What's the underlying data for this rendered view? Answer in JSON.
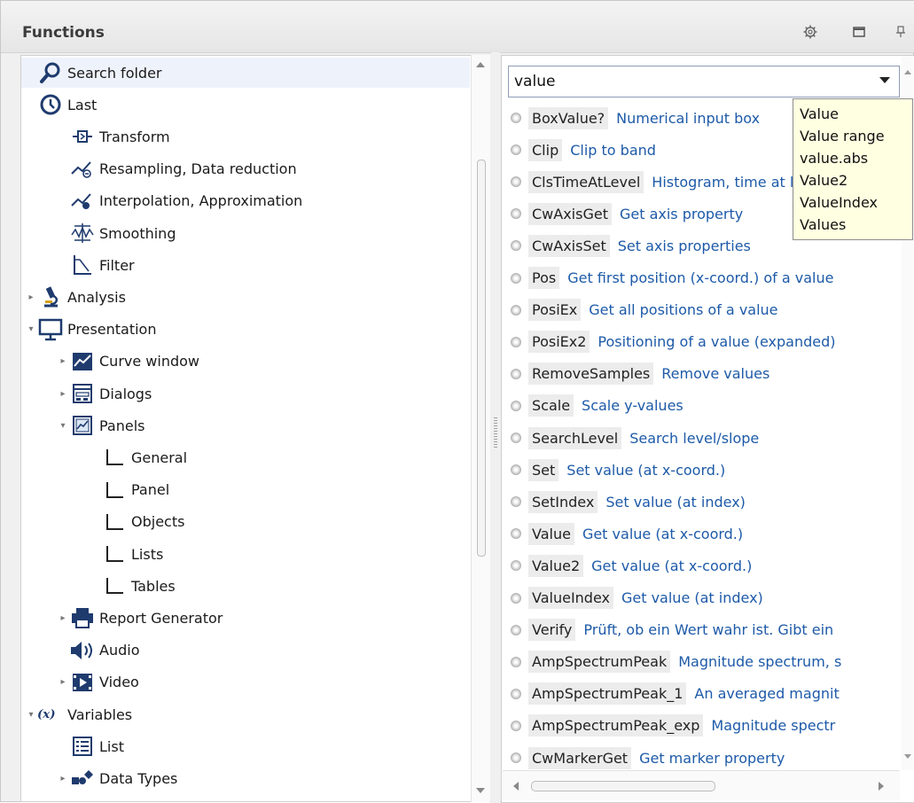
{
  "panel": {
    "title": "Functions",
    "buttons": [
      "settings",
      "maximize",
      "pin"
    ]
  },
  "tree": [
    {
      "label": "Search folder",
      "icon": "search-icon",
      "indent": 0,
      "arrow": "",
      "selected": true
    },
    {
      "label": "Last",
      "icon": "clock-icon",
      "indent": 0,
      "arrow": ""
    },
    {
      "label": "Transform",
      "icon": "transform-icon",
      "indent": 1,
      "arrow": ""
    },
    {
      "label": "Resampling, Data reduction",
      "icon": "resampling-icon",
      "indent": 1,
      "arrow": ""
    },
    {
      "label": "Interpolation, Approximation",
      "icon": "interpolation-icon",
      "indent": 1,
      "arrow": ""
    },
    {
      "label": "Smoothing",
      "icon": "smoothing-icon",
      "indent": 1,
      "arrow": ""
    },
    {
      "label": "Filter",
      "icon": "filter-icon",
      "indent": 1,
      "arrow": ""
    },
    {
      "label": "Analysis",
      "icon": "microscope-icon",
      "indent": 0,
      "arrow": "collapsed"
    },
    {
      "label": "Presentation",
      "icon": "monitor-icon",
      "indent": 0,
      "arrow": "expanded"
    },
    {
      "label": "Curve window",
      "icon": "curve-window-icon",
      "indent": 1,
      "arrow": "collapsed"
    },
    {
      "label": "Dialogs",
      "icon": "dialog-icon",
      "indent": 1,
      "arrow": "collapsed"
    },
    {
      "label": "Panels",
      "icon": "panels-icon",
      "indent": 1,
      "arrow": "expanded"
    },
    {
      "label": "General",
      "icon": "corner-icon",
      "indent": 2,
      "arrow": ""
    },
    {
      "label": "Panel",
      "icon": "corner-icon",
      "indent": 2,
      "arrow": ""
    },
    {
      "label": "Objects",
      "icon": "corner-icon",
      "indent": 2,
      "arrow": ""
    },
    {
      "label": "Lists",
      "icon": "corner-icon",
      "indent": 2,
      "arrow": ""
    },
    {
      "label": "Tables",
      "icon": "corner-icon",
      "indent": 2,
      "arrow": ""
    },
    {
      "label": "Report Generator",
      "icon": "printer-icon",
      "indent": 1,
      "arrow": "collapsed"
    },
    {
      "label": "Audio",
      "icon": "speaker-icon",
      "indent": 1,
      "arrow": ""
    },
    {
      "label": "Video",
      "icon": "film-icon",
      "indent": 1,
      "arrow": "collapsed"
    },
    {
      "label": "Variables",
      "icon": "variable-icon",
      "indent": 0,
      "arrow": "expanded"
    },
    {
      "label": "List",
      "icon": "list-icon",
      "indent": 1,
      "arrow": ""
    },
    {
      "label": "Data Types",
      "icon": "datatypes-icon",
      "indent": 1,
      "arrow": "collapsed"
    }
  ],
  "search": {
    "value": "value"
  },
  "functions": [
    {
      "name": "BoxValue?",
      "desc": "Numerical input box"
    },
    {
      "name": "Clip",
      "desc": "Clip to band"
    },
    {
      "name": "ClsTimeAtLevel",
      "desc": "Histogram, time at level"
    },
    {
      "name": "CwAxisGet",
      "desc": "Get axis property"
    },
    {
      "name": "CwAxisSet",
      "desc": "Set axis properties"
    },
    {
      "name": "Pos",
      "desc": "Get first position (x-coord.) of a value"
    },
    {
      "name": "PosiEx",
      "desc": "Get all positions of a value"
    },
    {
      "name": "PosiEx2",
      "desc": "Positioning of a value (expanded)"
    },
    {
      "name": "RemoveSamples",
      "desc": "Remove values"
    },
    {
      "name": "Scale",
      "desc": "Scale y-values"
    },
    {
      "name": "SearchLevel",
      "desc": "Search level/slope"
    },
    {
      "name": "Set",
      "desc": "Set value (at x-coord.)"
    },
    {
      "name": "SetIndex",
      "desc": "Set value (at index)"
    },
    {
      "name": "Value",
      "desc": "Get value (at x-coord.)"
    },
    {
      "name": "Value2",
      "desc": "Get value (at x-coord.)"
    },
    {
      "name": "ValueIndex",
      "desc": "Get value (at index)"
    },
    {
      "name": "Verify",
      "desc": "Prüft, ob ein Wert wahr ist. Gibt ein"
    },
    {
      "name": "AmpSpectrumPeak",
      "desc": "Magnitude spectrum, s"
    },
    {
      "name": "AmpSpectrumPeak_1",
      "desc": "An averaged magnit"
    },
    {
      "name": "AmpSpectrumPeak_exp",
      "desc": "Magnitude spectr"
    },
    {
      "name": "CwMarkerGet",
      "desc": "Get marker property"
    }
  ],
  "suggestions": [
    "Value",
    "Value range",
    "value.abs",
    "Value2",
    "ValueIndex",
    "Values"
  ]
}
